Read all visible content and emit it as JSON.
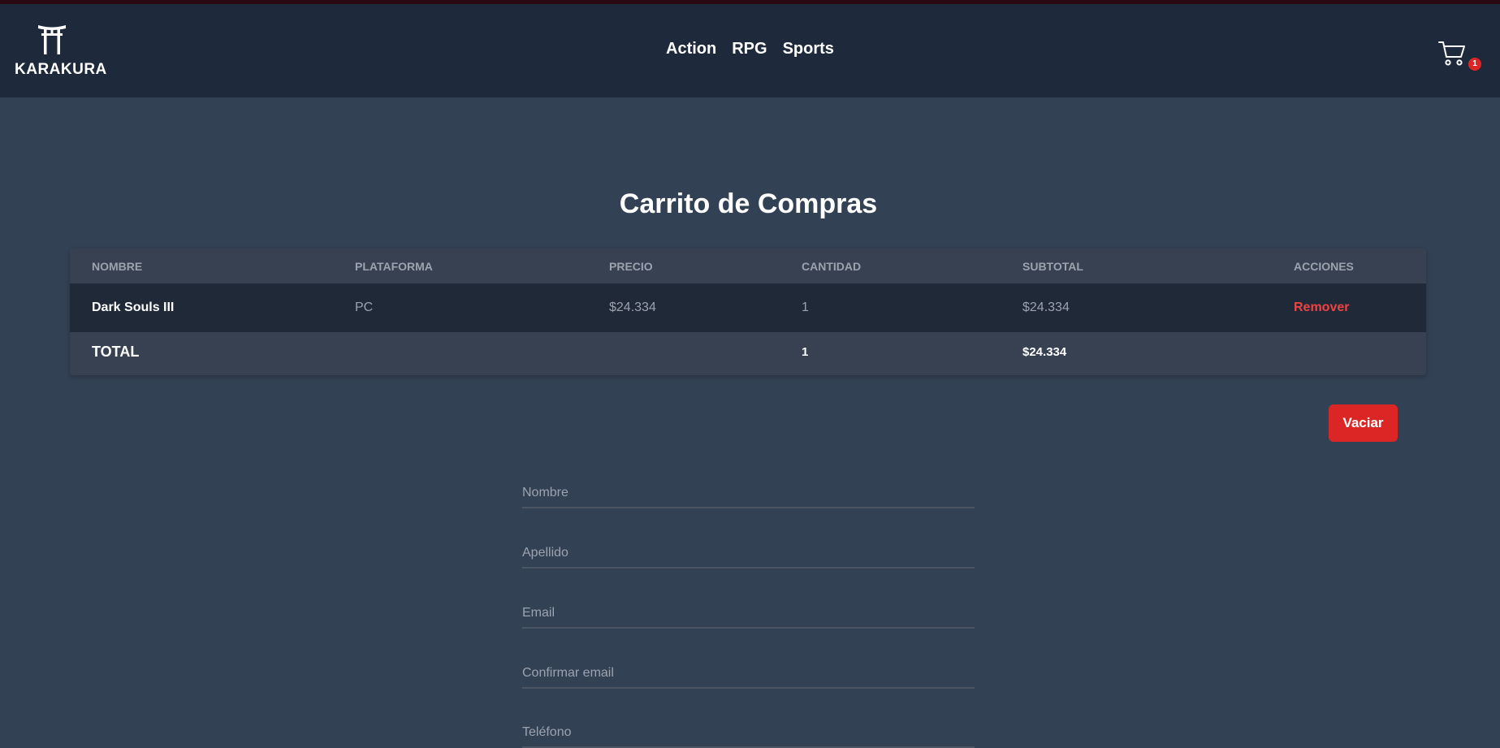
{
  "brand": {
    "name": "KARAKURA",
    "logo_icon": "torii-gate-icon"
  },
  "nav": {
    "items": [
      {
        "label": "Action"
      },
      {
        "label": "RPG"
      },
      {
        "label": "Sports"
      }
    ]
  },
  "cart": {
    "icon": "shopping-cart-icon",
    "count": "1"
  },
  "page": {
    "title": "Carrito de Compras"
  },
  "table": {
    "headers": [
      "NOMBRE",
      "PLATAFORMA",
      "PRECIO",
      "CANTIDAD",
      "SUBTOTAL",
      "ACCIONES"
    ],
    "rows": [
      {
        "nombre": "Dark Souls III",
        "plataforma": "PC",
        "precio": "$24.334",
        "cantidad": "1",
        "subtotal": "$24.334",
        "accion": "Remover"
      }
    ],
    "total": {
      "label": "TOTAL",
      "cantidad": "1",
      "subtotal": "$24.334"
    }
  },
  "actions": {
    "vaciar_label": "Vaciar"
  },
  "form": {
    "fields": [
      {
        "placeholder": "Nombre",
        "value": ""
      },
      {
        "placeholder": "Apellido",
        "value": ""
      },
      {
        "placeholder": "Email",
        "value": ""
      },
      {
        "placeholder": "Confirmar email",
        "value": ""
      },
      {
        "placeholder": "Teléfono",
        "value": ""
      }
    ]
  },
  "colors": {
    "page_bg": "#334155",
    "header_bg": "#1e293b",
    "accent_red": "#dc2626",
    "remove_red": "#ef4444"
  }
}
